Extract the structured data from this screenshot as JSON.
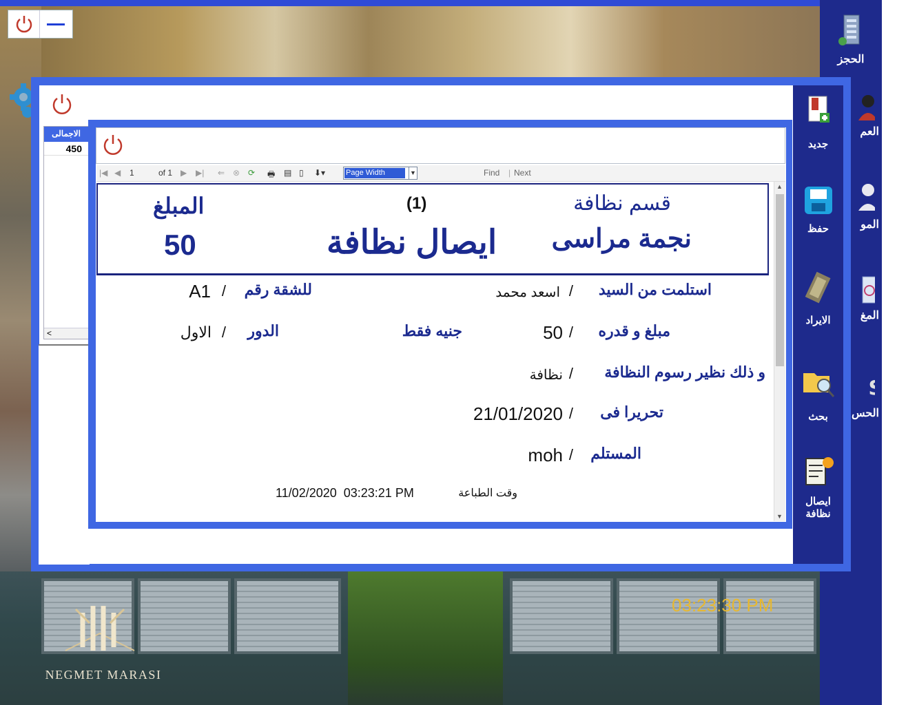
{
  "brand": {
    "logo_text": "NEGMET MARASI"
  },
  "clock": "03:23:30 PM",
  "sidebar": {
    "items": [
      {
        "label": "الحجز",
        "icon": "building-icon"
      },
      {
        "label": "العم",
        "icon": "user-icon"
      },
      {
        "label": "المو",
        "icon": "person-icon"
      },
      {
        "label": "المغ",
        "icon": "calendar-icon"
      },
      {
        "label": "الحس",
        "icon": "money-icon"
      }
    ]
  },
  "toolbar": {
    "items": [
      {
        "label": "جديد",
        "icon": "new-document-icon"
      },
      {
        "label": "حفظ",
        "icon": "save-icon"
      },
      {
        "label": "الايراد",
        "icon": "money-icon"
      },
      {
        "label": "بحث",
        "icon": "search-folder-icon"
      },
      {
        "label": "ايصال نظافة",
        "icon": "receipt-icon"
      }
    ]
  },
  "grid": {
    "header": "الاجمالى",
    "value": "450",
    "scroll_left": "<"
  },
  "report_toolbar": {
    "page": "1",
    "of": "of 1",
    "zoom": "Page Width",
    "find": "Find",
    "next": "Next"
  },
  "receipt": {
    "header": {
      "department": "قسم نظافة",
      "company": "نجمة مراسى",
      "number": "(1)",
      "title": "ايصال نظافة",
      "amount_label": "المبلغ",
      "amount_value": "50"
    },
    "received_from_label": "استلمت من السيد",
    "received_from_value": "اسعد محمد",
    "flat_label": "للشقة رقم",
    "flat_value": "A1",
    "sum_label": "مبلغ و قدره",
    "sum_value": "50",
    "currency": "جنيه فقط",
    "floor_label": "الدور",
    "floor_value": "الاول",
    "reason_label": "و ذلك نظير رسوم النظافة",
    "reason_value": "نظافة",
    "date_label": "تحريرا فى",
    "date_value": "21/01/2020",
    "receiver_label": "المستلم",
    "receiver_value": "moh",
    "print_time_label": "وقت الطباعة",
    "print_time_value": "11/02/2020  03:23:21 PM",
    "sep": "/"
  },
  "colors": {
    "accent": "#3f67e3",
    "sidebar": "#1e2a8c",
    "navy_text": "#1b2a8f",
    "clock": "#e7b830"
  }
}
